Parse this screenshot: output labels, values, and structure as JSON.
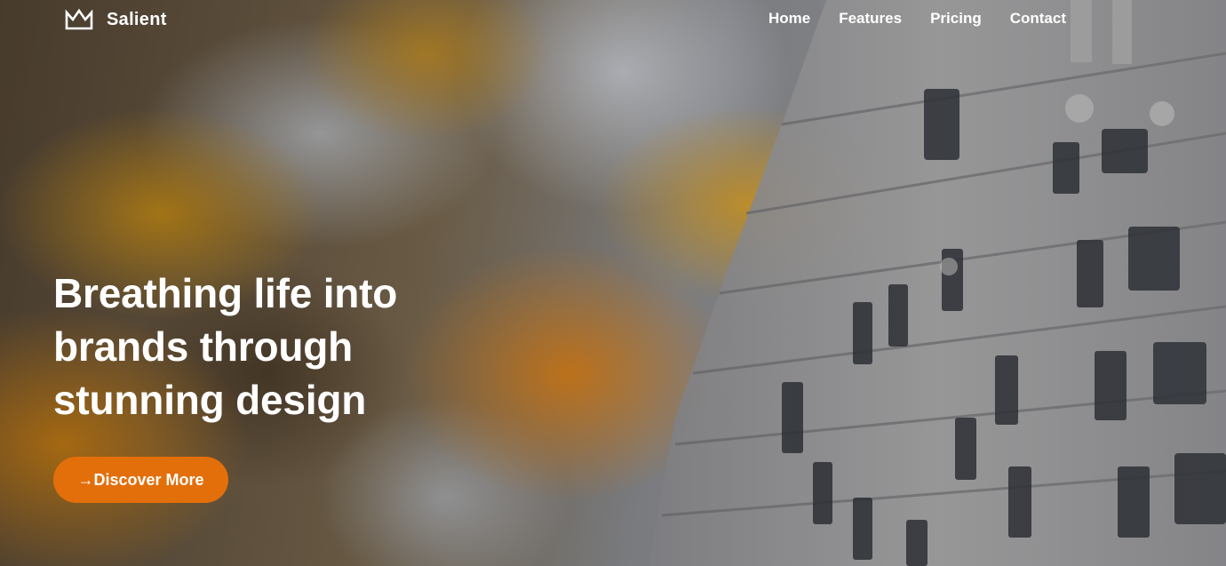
{
  "brand": {
    "name": "Salient",
    "logo_icon": "crown-icon"
  },
  "nav": {
    "items": [
      {
        "label": "Home"
      },
      {
        "label": "Features"
      },
      {
        "label": "Pricing"
      },
      {
        "label": "Contact"
      }
    ]
  },
  "hero": {
    "headline": "Breathing life into brands through stunning design",
    "cta": {
      "arrow": "→",
      "label": "Discover More",
      "color": "#e36f0a"
    }
  }
}
